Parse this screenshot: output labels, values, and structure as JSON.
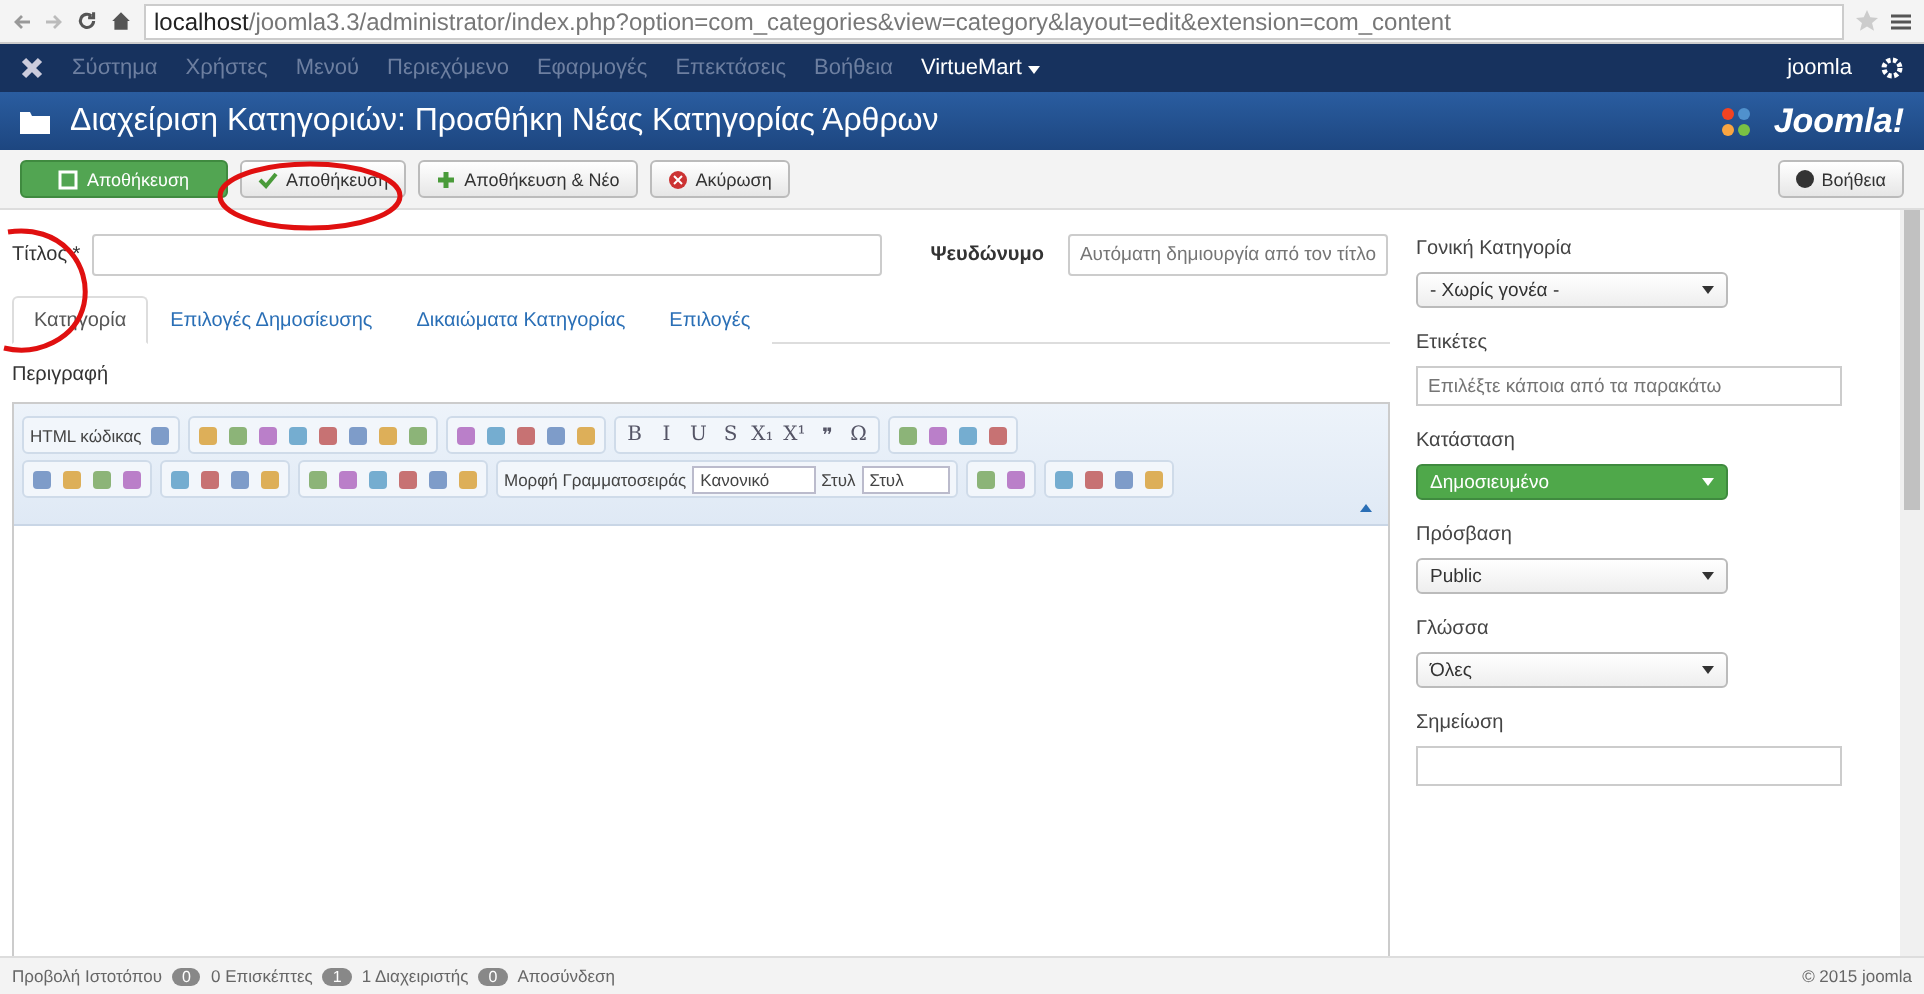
{
  "browser": {
    "url_host": "localhost",
    "url_path": "/joomla3.3/administrator/index.php?option=com_categories&view=category&layout=edit&extension=com_content"
  },
  "menu": {
    "items": [
      {
        "label": "Σύστημα",
        "disabled": true
      },
      {
        "label": "Χρήστες",
        "disabled": true
      },
      {
        "label": "Μενού",
        "disabled": true
      },
      {
        "label": "Περιεχόμενο",
        "disabled": true
      },
      {
        "label": "Εφαρμογές",
        "disabled": true
      },
      {
        "label": "Επεκτάσεις",
        "disabled": true
      },
      {
        "label": "Βοήθεια",
        "disabled": true
      },
      {
        "label": "VirtueMart",
        "disabled": false
      }
    ],
    "user": "joomla"
  },
  "header": {
    "title": "Διαχείριση Κατηγοριών: Προσθήκη Νέας Κατηγορίας Άρθρων",
    "logo": "Joomla!"
  },
  "toolbar": {
    "buttons": [
      {
        "label": "Αποθήκευση",
        "kind": "primary"
      },
      {
        "label": "Αποθήκευση",
        "kind": "default"
      },
      {
        "label": "Αποθήκευση & Νέο",
        "kind": "default"
      },
      {
        "label": "Ακύρωση",
        "kind": "default"
      }
    ],
    "help": "Βοήθεια"
  },
  "form": {
    "title_label": "Τίτλος *",
    "alias_label": "Ψευδώνυμο",
    "alias_placeholder": "Αυτόματη δημιουργία από τον τίτλο"
  },
  "tabs": [
    {
      "label": "Κατηγορία",
      "selected": true
    },
    {
      "label": "Επιλογές Δημοσίευσης",
      "selected": false
    },
    {
      "label": "Δικαιώματα Κατηγορίας",
      "selected": false
    },
    {
      "label": "Επιλογές",
      "selected": false
    }
  ],
  "description_label": "Περιγραφή",
  "editor_rows": [
    [
      [
        {
          "kind": "html",
          "label": "HTML κώδικας"
        },
        {
          "kind": "icon"
        }
      ],
      [
        {
          "kind": "icon"
        },
        {
          "kind": "icon"
        },
        {
          "kind": "icon"
        },
        {
          "kind": "icon"
        },
        {
          "kind": "icon"
        },
        {
          "kind": "icon"
        },
        {
          "kind": "icon"
        },
        {
          "kind": "icon"
        }
      ],
      [
        {
          "kind": "icon"
        },
        {
          "kind": "icon"
        },
        {
          "kind": "icon"
        },
        {
          "kind": "icon"
        },
        {
          "kind": "icon"
        }
      ],
      [
        {
          "kind": "glyph",
          "label": "B"
        },
        {
          "kind": "glyph",
          "label": "I"
        },
        {
          "kind": "glyph",
          "label": "U"
        },
        {
          "kind": "glyph",
          "label": "S"
        },
        {
          "kind": "glyph",
          "label": "X₁"
        },
        {
          "kind": "glyph",
          "label": "X¹"
        },
        {
          "kind": "glyph",
          "label": "❞"
        },
        {
          "kind": "glyph",
          "label": "Ω"
        }
      ],
      [
        {
          "kind": "icon"
        },
        {
          "kind": "icon"
        },
        {
          "kind": "icon"
        },
        {
          "kind": "icon"
        }
      ]
    ],
    [
      [
        {
          "kind": "icon"
        },
        {
          "kind": "icon"
        },
        {
          "kind": "icon"
        },
        {
          "kind": "icon"
        }
      ],
      [
        {
          "kind": "icon"
        },
        {
          "kind": "icon"
        },
        {
          "kind": "icon"
        },
        {
          "kind": "icon"
        }
      ],
      [
        {
          "kind": "icon"
        },
        {
          "kind": "icon"
        },
        {
          "kind": "icon"
        },
        {
          "kind": "icon"
        },
        {
          "kind": "icon"
        },
        {
          "kind": "icon"
        }
      ],
      [
        {
          "kind": "label",
          "label": "Μορφή Γραμματοσειράς"
        },
        {
          "kind": "select",
          "label": "Κανονικό"
        },
        {
          "kind": "label",
          "label": "Στυλ"
        },
        {
          "kind": "select",
          "label": "Στυλ"
        }
      ],
      [
        {
          "kind": "icon"
        },
        {
          "kind": "icon"
        }
      ],
      [
        {
          "kind": "icon"
        },
        {
          "kind": "icon"
        },
        {
          "kind": "icon"
        },
        {
          "kind": "icon"
        }
      ]
    ]
  ],
  "sidebar": [
    {
      "label": "Γονική Κατηγορία",
      "kind": "select",
      "value": "- Χωρίς γονέα -"
    },
    {
      "label": "Ετικέτες",
      "kind": "input",
      "placeholder": "Επιλέξτε κάποια από τα παρακάτω"
    },
    {
      "label": "Κατάσταση",
      "kind": "status",
      "value": "Δημοσιευμένο"
    },
    {
      "label": "Πρόσβαση",
      "kind": "select",
      "value": "Public"
    },
    {
      "label": "Γλώσσα",
      "kind": "select",
      "value": "Όλες"
    },
    {
      "label": "Σημείωση",
      "kind": "input"
    }
  ],
  "status_bar": {
    "view_site": "Προβολή Ιστοτόπου",
    "visitors_count": "0",
    "visitors": "0 Επισκέπτες",
    "admins_count": "1",
    "admins": "1 Διαχειριστής",
    "messages_count": "0",
    "logout": "Αποσύνδεση",
    "copyright": "© 2015 joomla"
  }
}
